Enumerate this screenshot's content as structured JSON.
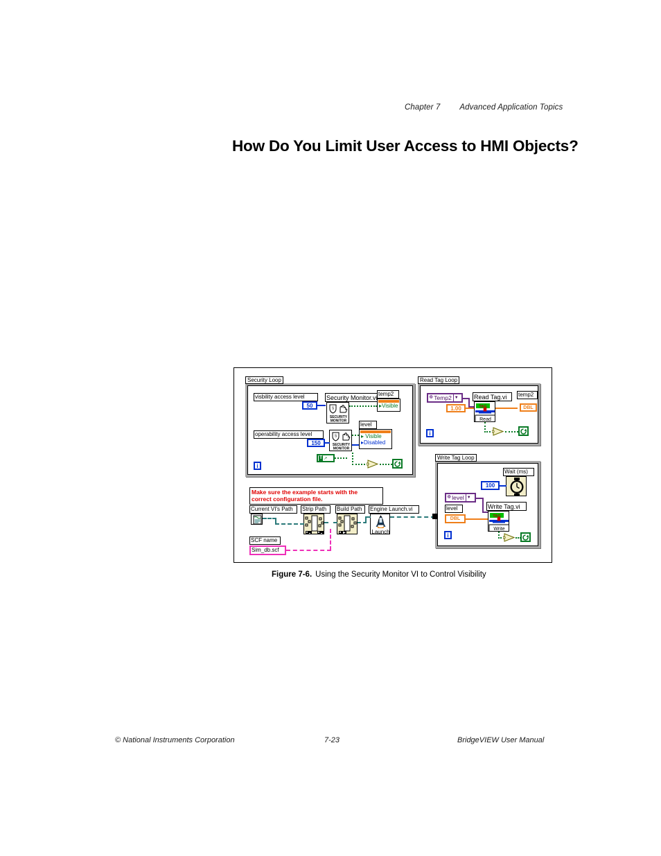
{
  "header": {
    "chapter": "Chapter 7",
    "section": "Advanced Application Topics",
    "title": "How Do You Limit User Access to HMI Objects?"
  },
  "figure": {
    "caption_number": "Figure 7-6.",
    "caption_text": "Using the Security Monitor VI to Control Visibility",
    "security_loop": {
      "title": "Security Loop",
      "visibility_label": "visbility access level",
      "visibility_value": "50",
      "operability_label": "operability access level",
      "operability_value": "150",
      "vi_title": "Security Monitor.vi",
      "vi_icon_line1": "SECURITY",
      "vi_icon_line2": "MONITOR",
      "bool_const": "T",
      "temp2_label": "temp2",
      "temp2_property": "Visible",
      "level_label": "level",
      "level_property_1": "Visible",
      "level_property_2": "Disabled",
      "iteration_terminal": "i"
    },
    "read_tag_loop": {
      "title": "Read Tag Loop",
      "tag_name": "Temp2",
      "timeout_value": "1.00",
      "vi_title": "Read Tag.vi",
      "vi_icon_label": "Read",
      "vi_icon_badge": "TAG",
      "indicator_label": "temp2",
      "indicator_type": "DBL",
      "iteration_terminal": "i"
    },
    "write_tag_loop": {
      "title": "Write Tag Loop",
      "wait_label": "Wait (ms)",
      "wait_value": "100",
      "tag_name": "level",
      "control_label": "level",
      "control_type": "DBL",
      "vi_title": "Write Tag.vi",
      "vi_icon_label": "Write",
      "vi_icon_badge": "TAG",
      "iteration_terminal": "i"
    },
    "startup_section": {
      "note_line1": "Make sure the example starts with the",
      "note_line2": "correct configuration file.",
      "current_path_label": "Current VI's Path",
      "strip_path_label": "Strip Path",
      "build_path_label": "Build Path",
      "engine_launch_label": "Engine Launch.vi",
      "engine_launch_icon_text": "Launch",
      "scf_name_label": "SCF name",
      "scf_value": "Sim_db.scf"
    }
  },
  "footer": {
    "left": "© National Instruments Corporation",
    "page": "7-23",
    "right": "BridgeVIEW User Manual"
  },
  "colors": {
    "wire_blue": "#0030d0",
    "wire_orange": "#ef7f1a",
    "wire_green": "#0a7a26",
    "wire_purple": "#6b2d86",
    "wire_pink": "#ee2fb8",
    "wire_path": "#2a7a7a",
    "note_red": "#e00000",
    "loop_gray": "#a8a8a8"
  }
}
